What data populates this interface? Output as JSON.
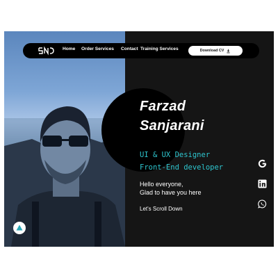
{
  "nav": {
    "logo": "SNJ",
    "links": [
      "Home",
      "Order Services",
      "Contact",
      "Training Services"
    ],
    "cta_label": "Download CV"
  },
  "hero": {
    "first_name": "Farzad",
    "last_name": "Sanjarani",
    "role_1": "UI & UX Designer",
    "role_2": "Front-End developer",
    "greeting_1": "Hello everyone,",
    "greeting_2": "Glad to have you here",
    "scroll_label": "Let's Scroll Down"
  },
  "social": [
    "google-icon",
    "linkedin-icon",
    "whatsapp-icon"
  ],
  "colors": {
    "background": "#151515",
    "accent": "#2ec6cf",
    "fab_triangle": "#2aa8b8"
  }
}
